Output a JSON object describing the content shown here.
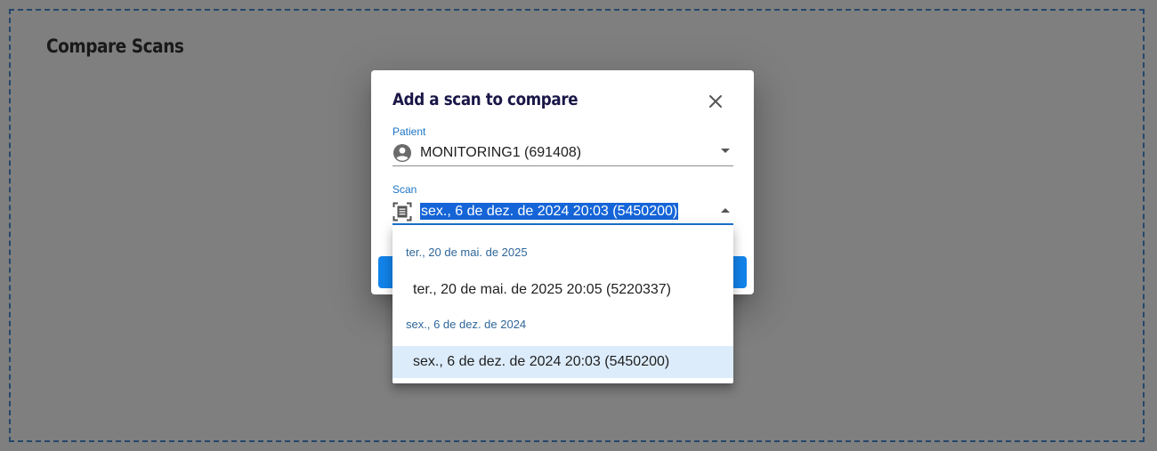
{
  "page": {
    "title": "Compare Scans"
  },
  "dialog": {
    "title": "Add a scan to compare",
    "close_icon": "close-icon",
    "patient": {
      "label": "Patient",
      "value": "MONITORING1 (691408)",
      "icon": "account-circle-icon"
    },
    "scan": {
      "label": "Scan",
      "value": "sex., 6 de dez. de 2024 20:03 (5450200)",
      "icon": "scan-document-icon"
    }
  },
  "dropdown": {
    "groups": [
      {
        "header": "ter., 20 de mai. de 2025",
        "options": [
          "ter., 20 de mai. de 2025 20:05 (5220337)"
        ]
      },
      {
        "header": "sex., 6 de dez. de 2024",
        "options": [
          "sex., 6 de dez. de 2024 20:03 (5450200)"
        ]
      }
    ]
  },
  "colors": {
    "accent": "#1976d2",
    "selected_option_bg": "#ddecfb",
    "title_text": "#1a1747",
    "dashed_border": "#4a8fd6"
  }
}
